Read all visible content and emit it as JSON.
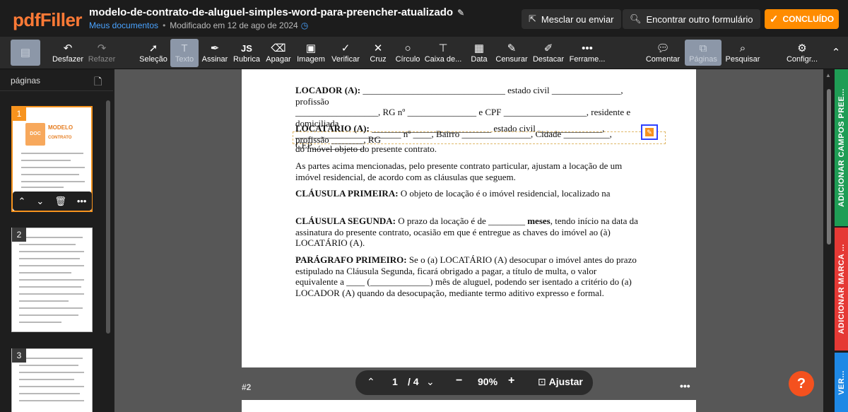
{
  "header": {
    "logo": "pdfFiller",
    "title": "modelo-de-contrato-de-aluguel-simples-word-para-preencher-atualizado",
    "breadcrumb_link": "Meus documentos",
    "modified": "Modificado em 12 de ago de 2024",
    "merge_label": "Mesclar ou enviar",
    "find_label": "Encontrar outro formulário",
    "done_label": "CONCLUÍDO",
    "accent_color": "#ff8c00"
  },
  "toolbar": {
    "undo": "Desfazer",
    "redo": "Refazer",
    "select": "Seleção",
    "text": "Texto",
    "sign": "Assinar",
    "initials": "Rubrica",
    "erase": "Apagar",
    "image": "Imagem",
    "check": "Verificar",
    "cross": "Cruz",
    "circle": "Círculo",
    "textbox": "Caixa de...",
    "date": "Data",
    "redact": "Censurar",
    "highlight": "Destacar",
    "more_tools": "Ferrame...",
    "comment": "Comentar",
    "pages": "Páginas",
    "search": "Pesquisar",
    "settings": "Configr..."
  },
  "sidebar": {
    "title": "páginas",
    "pages": [
      "1",
      "2",
      "3"
    ],
    "thumb1_title": "MODELO",
    "thumb1_subtitle": "CONTRATO",
    "thumb1_icon": "DOC"
  },
  "document": {
    "locador_label": "LOCADOR (A):",
    "locador_text1": " _______________________________ estado civil _______________, profissão",
    "locador_text2": "__________________, RG nº _______________ e CPF __________________, residente e domiciliada",
    "locador_text3": "_______________________ nº ____, Bairro _______________, Cidade __________, CEP___________.",
    "locatario_label": "LOCATÁRIO (A):",
    "locatario_text": " __________________________ estado civil ______________, profissão _______, RG",
    "locatario_text2": "do imóvel objeto do presente contrato.",
    "intro": "As partes acima mencionadas, pelo presente contrato particular, ajustam a locação de um imóvel residencial, de acordo com as cláusulas que seguem.",
    "clause1_label": "CLÁUSULA PRIMEIRA:",
    "clause1_text": " O objeto de locação é o imóvel residencial, localizado na",
    "clause2_label": "CLÁUSULA SEGUNDA:",
    "clause2_text_a": " O prazo da locação é de ________ ",
    "clause2_bold": "meses",
    "clause2_text_b": ", tendo início na data da assinatura do presente contrato, ocasião em que é entregue as chaves do imóvel ao (à) LOCATÁRIO (A).",
    "para1_label": "PARÁGRAFO PRIMEIRO:",
    "para1_text": " Se o (a) LOCATÁRIO (A) desocupar o imóvel antes do prazo estipulado na Cláusula Segunda, ficará obrigado a pagar, a título de multa, o valor equivalente a ____ (_____________) mês de aluguel, podendo ser isentado a critério do (a) LOCADOR (A) quando da desocupação, mediante termo aditivo expresso e formal.",
    "next_page_label": "#2"
  },
  "zoombar": {
    "current_page": "1",
    "total_pages": "/ 4",
    "zoom": "90%",
    "fit_label": "Ajustar"
  },
  "right_tabs": {
    "add_fields": "ADICIONAR CAMPOS PREE...",
    "add_watermark": "ADICIONAR MARCA ...",
    "verify": "VER..."
  },
  "help": "?"
}
